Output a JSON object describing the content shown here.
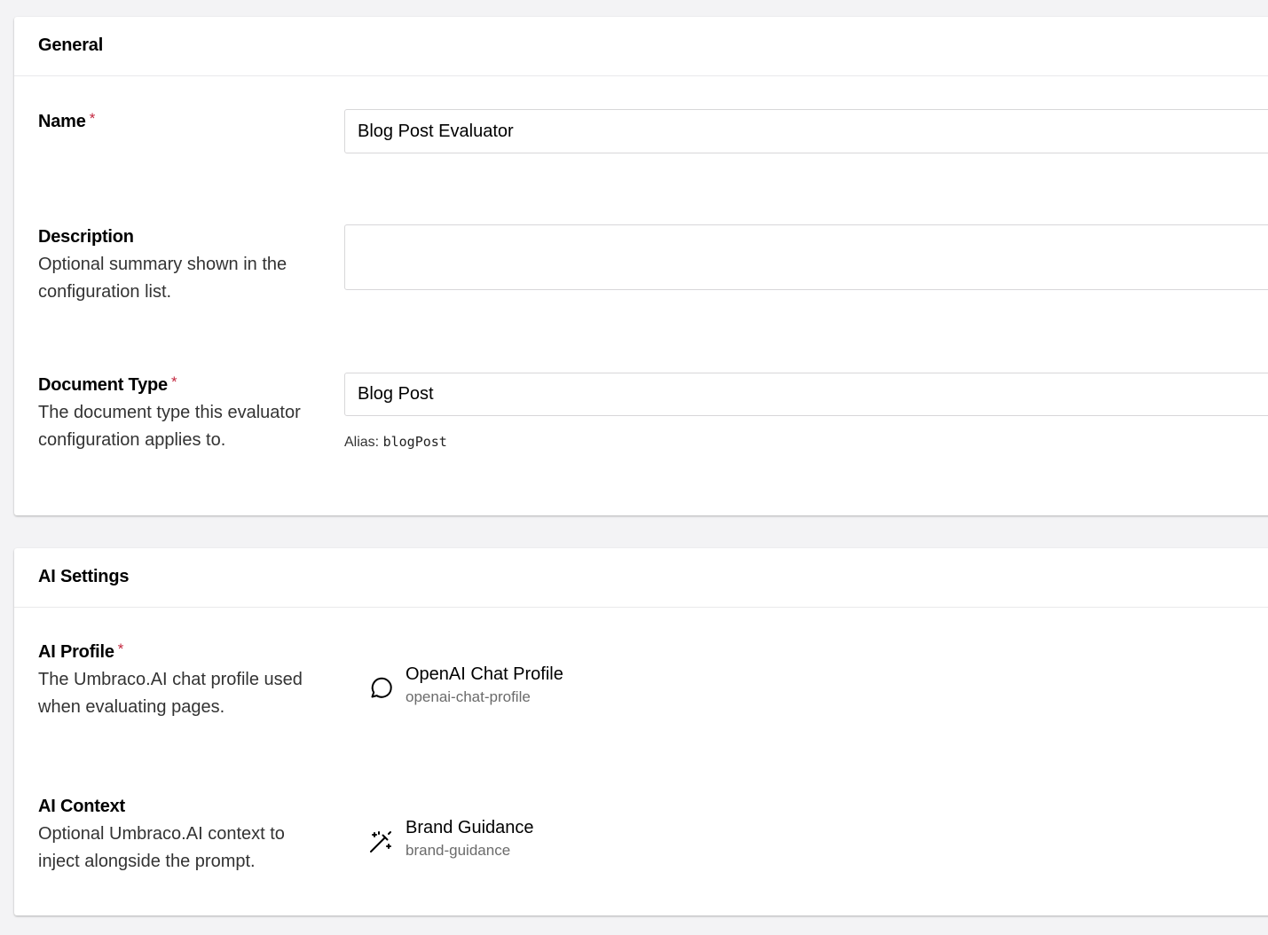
{
  "general": {
    "title": "General",
    "name": {
      "label": "Name",
      "required_marker": "*",
      "value": "Blog Post Evaluator"
    },
    "description": {
      "label": "Description",
      "help": "Optional summary shown in the configuration list.",
      "value": ""
    },
    "document_type": {
      "label": "Document Type",
      "required_marker": "*",
      "help": "The document type this evaluator configuration applies to.",
      "value": "Blog Post",
      "alias_label": "Alias:",
      "alias_value": "blogPost"
    }
  },
  "ai_settings": {
    "title": "AI Settings",
    "profile": {
      "label": "AI Profile",
      "required_marker": "*",
      "help": "The Umbraco.AI chat profile used when evaluating pages.",
      "item_name": "OpenAI Chat Profile",
      "item_alias": "openai-chat-profile",
      "icon": "chat-bubble-icon"
    },
    "context": {
      "label": "AI Context",
      "help": "Optional Umbraco.AI context to inject alongside the prompt.",
      "item_name": "Brand Guidance",
      "item_alias": "brand-guidance",
      "icon": "magic-wand-icon"
    }
  },
  "colors": {
    "background": "#f3f3f5",
    "required": "#c3273f",
    "border": "#d8d7d9"
  }
}
